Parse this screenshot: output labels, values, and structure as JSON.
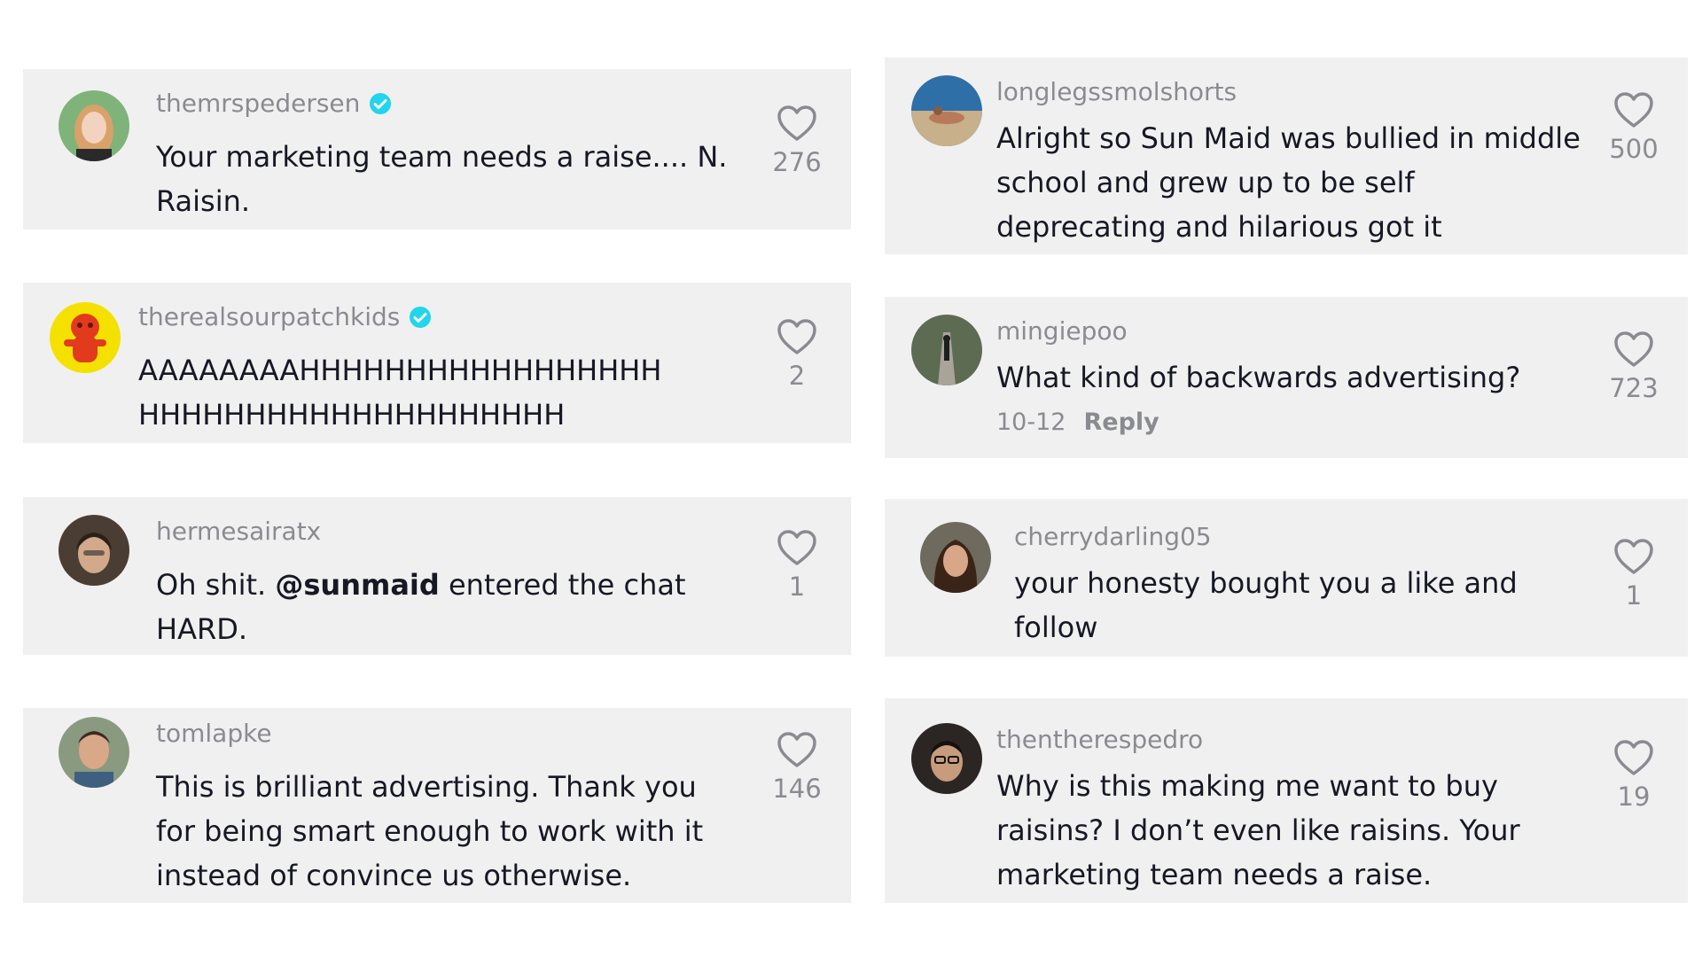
{
  "comments": [
    {
      "username": "themrspedersen",
      "verified": true,
      "lines": [
        "Your marketing team needs a raise.... N.",
        "Raisin."
      ],
      "likes": "276",
      "avatar_color": "#c9b79c"
    },
    {
      "username": "therealsourpatchkids",
      "verified": true,
      "lines": [
        "AAAAAAAAHHHHHHHHHHHHHHHHH",
        "HHHHHHHHHHHHHHHHHHHH"
      ],
      "likes": "2",
      "avatar_color": "#f5e100"
    },
    {
      "username": "hermesairatx",
      "verified": false,
      "line1_pre": "Oh shit. ",
      "line1_mention": "@sunmaid",
      "line1_post": " entered the chat",
      "line2": "HARD.",
      "likes": "1",
      "avatar_color": "#6b5a4a"
    },
    {
      "username": "tomlapke",
      "verified": false,
      "lines": [
        "This is brilliant advertising. Thank you",
        "for being smart enough to work with it",
        "instead of convince us otherwise."
      ],
      "likes": "146",
      "avatar_color": "#5a6a55"
    },
    {
      "username": "longlegssmolshorts",
      "verified": false,
      "lines": [
        "Alright so Sun Maid was bullied in middle",
        "school and grew up to be self",
        "deprecating and hilarious got it"
      ],
      "likes": "500",
      "avatar_color": "#4e7fb0"
    },
    {
      "username": "mingiepoo",
      "verified": false,
      "lines": [
        "What kind of backwards advertising?"
      ],
      "date": "10-12",
      "reply_label": "Reply",
      "likes": "723",
      "avatar_color": "#3d4a3a"
    },
    {
      "username": "cherrydarling05",
      "verified": false,
      "lines": [
        "your honesty bought you a like and",
        "follow"
      ],
      "likes": "1",
      "avatar_color": "#7a5a48"
    },
    {
      "username": "thentherespedro",
      "verified": false,
      "lines": [
        "Why is this making me want to buy",
        "raisins? I don’t even like raisins. Your",
        "marketing team needs a raise."
      ],
      "likes": "19",
      "avatar_color": "#3b3230"
    }
  ],
  "icons": {
    "like": "heart-outline-icon",
    "verified": "verified-badge-icon"
  },
  "colors": {
    "card_bg": "#f1f0f1",
    "username": "#8a8b91",
    "text": "#161823",
    "verified": "#20d5ec"
  }
}
